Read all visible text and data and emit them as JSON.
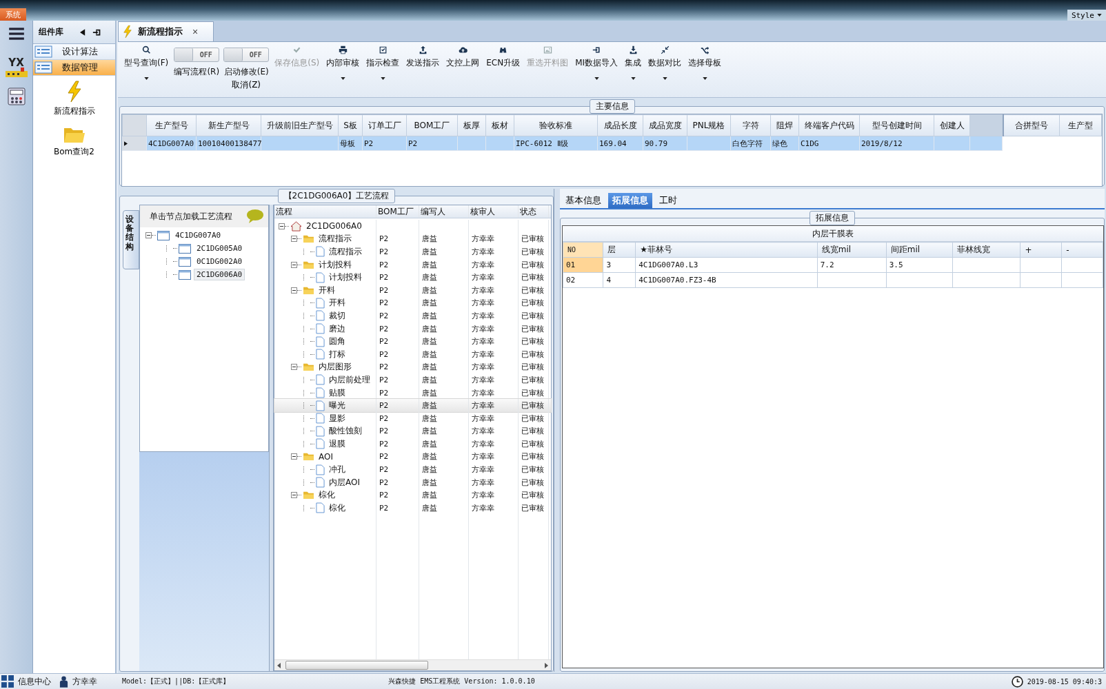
{
  "top_bar": {
    "system_tab": "系统",
    "style_label": "Style"
  },
  "rail": {
    "logo_text": "YX"
  },
  "component_panel": {
    "title": "组件库",
    "categories": [
      {
        "label": "设计算法",
        "selected": false
      },
      {
        "label": "数据管理",
        "selected": true
      }
    ],
    "tools": [
      {
        "label": "新流程指示",
        "kind": "lightning"
      },
      {
        "label": "Bom查询2",
        "kind": "folder"
      }
    ]
  },
  "document_tab": {
    "label": "新流程指示",
    "close": "×"
  },
  "toolbar": [
    {
      "kind": "button",
      "label": "型号查询(F)",
      "disabled": false,
      "dropdown": true
    },
    {
      "kind": "toggle",
      "label": "编写流程(R)",
      "state_label": "OFF",
      "on": false
    },
    {
      "kind": "toggle",
      "label": "启动修改(E)",
      "sub_label": "取消(Z)",
      "state_label": "OFF",
      "on": false
    },
    {
      "kind": "button",
      "label": "保存信息(S)",
      "disabled": true,
      "dropdown": false
    },
    {
      "kind": "button",
      "label": "内部审核",
      "disabled": false,
      "dropdown": true
    },
    {
      "kind": "button",
      "label": "指示检查",
      "disabled": false,
      "dropdown": true
    },
    {
      "kind": "button",
      "label": "发送指示",
      "disabled": false,
      "dropdown": false
    },
    {
      "kind": "button",
      "label": "文控上网",
      "disabled": false,
      "dropdown": false
    },
    {
      "kind": "button",
      "label": "ECN升级",
      "disabled": false,
      "dropdown": false
    },
    {
      "kind": "button",
      "label": "重选开料图",
      "disabled": true,
      "dropdown": false
    },
    {
      "kind": "button",
      "label": "MI数据导入",
      "disabled": false,
      "dropdown": true
    },
    {
      "kind": "button",
      "label": "集成",
      "disabled": false,
      "dropdown": true
    },
    {
      "kind": "button",
      "label": "数据对比",
      "disabled": false,
      "dropdown": true
    },
    {
      "kind": "button",
      "label": "选择母板",
      "disabled": false,
      "dropdown": true
    }
  ],
  "main_info": {
    "title": "主要信息",
    "columns": [
      "生产型号",
      "新生产型号",
      "升级前旧生产型号",
      "S板",
      "订单工厂",
      "BOM工厂",
      "板厚",
      "板材",
      "验收标准",
      "成品长度",
      "成品宽度",
      "PNL规格",
      "字符",
      "阻焊",
      "终端客户代码",
      "型号创建时间",
      "创建人"
    ],
    "rows": [
      {
        "selected": true,
        "cells": [
          "4C1DG007A0",
          "10010400138477",
          "",
          "母板",
          "P2",
          "P2",
          "",
          "",
          "IPC-6012 Ⅱ级",
          "169.04",
          "90.79",
          "",
          "白色字符",
          "绿色",
          "C1DG",
          "2019/8/12",
          ""
        ]
      }
    ],
    "merge_columns": [
      "合拼型号",
      "生产型"
    ]
  },
  "process": {
    "title": "【2C1DG006A0】工艺流程",
    "side_tab": "设备结构",
    "device_hint": "单击节点加载工艺流程",
    "device_tree": [
      {
        "label": "4C1DG007A0",
        "expanded": true,
        "selected": false,
        "children": [
          {
            "label": "2C1DG005A0",
            "selected": false
          },
          {
            "label": "0C1DG002A0",
            "selected": false
          },
          {
            "label": "2C1DG006A0",
            "selected": true
          }
        ]
      }
    ],
    "columns": [
      "流程",
      "BOM工厂",
      "编写人",
      "核审人",
      "状态"
    ],
    "tree": [
      {
        "kind": "home",
        "label": "2C1DG006A0",
        "expanded": true,
        "selected": false,
        "children": [
          {
            "kind": "folder",
            "label": "流程指示",
            "bom": "P2",
            "writer": "唐益",
            "reviewer": "方幸幸",
            "status": "已审核",
            "expanded": true,
            "selected": false,
            "children": [
              {
                "kind": "page",
                "label": "流程指示",
                "bom": "P2",
                "writer": "唐益",
                "reviewer": "方幸幸",
                "status": "已审核",
                "selected": false
              }
            ]
          },
          {
            "kind": "folder",
            "label": "计划投料",
            "bom": "P2",
            "writer": "唐益",
            "reviewer": "方幸幸",
            "status": "已审核",
            "expanded": true,
            "selected": false,
            "children": [
              {
                "kind": "page",
                "label": "计划投料",
                "bom": "P2",
                "writer": "唐益",
                "reviewer": "方幸幸",
                "status": "已审核",
                "selected": false
              }
            ]
          },
          {
            "kind": "folder",
            "label": "开料",
            "bom": "P2",
            "writer": "唐益",
            "reviewer": "方幸幸",
            "status": "已审核",
            "expanded": true,
            "selected": false,
            "children": [
              {
                "kind": "page",
                "label": "开料",
                "bom": "P2",
                "writer": "唐益",
                "reviewer": "方幸幸",
                "status": "已审核",
                "selected": false
              },
              {
                "kind": "page",
                "label": "裁切",
                "bom": "P2",
                "writer": "唐益",
                "reviewer": "方幸幸",
                "status": "已审核",
                "selected": false
              },
              {
                "kind": "page",
                "label": "磨边",
                "bom": "P2",
                "writer": "唐益",
                "reviewer": "方幸幸",
                "status": "已审核",
                "selected": false
              },
              {
                "kind": "page",
                "label": "圆角",
                "bom": "P2",
                "writer": "唐益",
                "reviewer": "方幸幸",
                "status": "已审核",
                "selected": false
              },
              {
                "kind": "page",
                "label": "打标",
                "bom": "P2",
                "writer": "唐益",
                "reviewer": "方幸幸",
                "status": "已审核",
                "selected": false
              }
            ]
          },
          {
            "kind": "folder",
            "label": "内层图形",
            "bom": "P2",
            "writer": "唐益",
            "reviewer": "方幸幸",
            "status": "已审核",
            "expanded": true,
            "selected": false,
            "children": [
              {
                "kind": "page",
                "label": "内层前处理",
                "bom": "P2",
                "writer": "唐益",
                "reviewer": "方幸幸",
                "status": "已审核",
                "selected": false
              },
              {
                "kind": "page",
                "label": "贴膜",
                "bom": "P2",
                "writer": "唐益",
                "reviewer": "方幸幸",
                "status": "已审核",
                "selected": false
              },
              {
                "kind": "page",
                "label": "曝光",
                "bom": "P2",
                "writer": "唐益",
                "reviewer": "方幸幸",
                "status": "已审核",
                "selected": true
              },
              {
                "kind": "page",
                "label": "显影",
                "bom": "P2",
                "writer": "唐益",
                "reviewer": "方幸幸",
                "status": "已审核",
                "selected": false
              },
              {
                "kind": "page",
                "label": "酸性蚀刻",
                "bom": "P2",
                "writer": "唐益",
                "reviewer": "方幸幸",
                "status": "已审核",
                "selected": false
              },
              {
                "kind": "page",
                "label": "退膜",
                "bom": "P2",
                "writer": "唐益",
                "reviewer": "方幸幸",
                "status": "已审核",
                "selected": false
              }
            ]
          },
          {
            "kind": "folder",
            "label": "AOI",
            "bom": "P2",
            "writer": "唐益",
            "reviewer": "方幸幸",
            "status": "已审核",
            "expanded": true,
            "selected": false,
            "children": [
              {
                "kind": "page",
                "label": "冲孔",
                "bom": "P2",
                "writer": "唐益",
                "reviewer": "方幸幸",
                "status": "已审核",
                "selected": false
              },
              {
                "kind": "page",
                "label": "内层AOI",
                "bom": "P2",
                "writer": "唐益",
                "reviewer": "方幸幸",
                "status": "已审核",
                "selected": false
              }
            ]
          },
          {
            "kind": "folder",
            "label": "棕化",
            "bom": "P2",
            "writer": "唐益",
            "reviewer": "方幸幸",
            "status": "已审核",
            "expanded": true,
            "selected": false,
            "children": [
              {
                "kind": "page",
                "label": "棕化",
                "bom": "P2",
                "writer": "唐益",
                "reviewer": "方幸幸",
                "status": "已审核",
                "selected": false
              }
            ]
          }
        ]
      }
    ]
  },
  "detail": {
    "tabs": [
      {
        "label": "基本信息",
        "selected": false
      },
      {
        "label": "拓展信息",
        "selected": true
      },
      {
        "label": "工时",
        "selected": false
      }
    ],
    "group_title": "拓展信息",
    "table_title": "内层干膜表",
    "columns": [
      "NO",
      "层",
      "★菲林号",
      "线宽mil",
      "间距mil",
      "菲林线宽",
      "+",
      "-"
    ],
    "rows": [
      {
        "current": true,
        "cells": [
          "01",
          "3",
          "4C1DG007A0.L3",
          "7.2",
          "3.5",
          "",
          "",
          ""
        ]
      },
      {
        "current": false,
        "cells": [
          "02",
          "4",
          "4C1DG007A0.FZ3-4B",
          "",
          "",
          "",
          "",
          ""
        ]
      }
    ]
  },
  "status_bar": {
    "info_center": "信息中心",
    "user": "方幸幸",
    "model": "Model:【正式】||DB:【正式库】",
    "system": "兴森快捷 EMS工程系统 Version: 1.0.0.10",
    "time": "2019-08-15 09:40:3"
  }
}
